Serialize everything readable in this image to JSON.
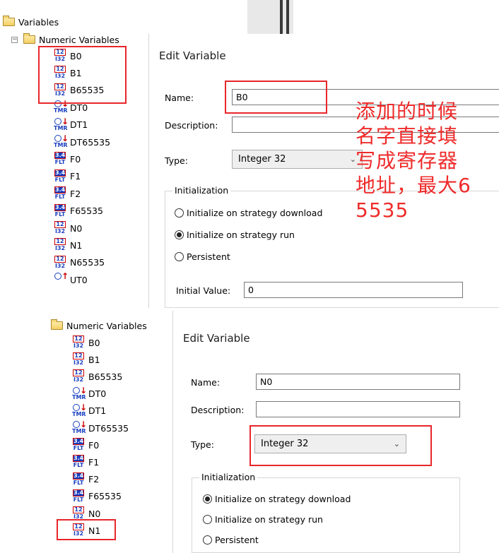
{
  "tree_top": {
    "root_label": "Variables",
    "folder_label": "Numeric Variables",
    "items": [
      {
        "label": "B0",
        "icon": "integer-32-icon",
        "badge_top": "12",
        "badge_bottom": "I32"
      },
      {
        "label": "B1",
        "icon": "integer-32-icon",
        "badge_top": "12",
        "badge_bottom": "I32"
      },
      {
        "label": "B65535",
        "icon": "integer-32-icon",
        "badge_top": "12",
        "badge_bottom": "I32"
      },
      {
        "label": "DT0",
        "icon": "timer-icon",
        "badge_top": "",
        "badge_bottom": "TMR"
      },
      {
        "label": "DT1",
        "icon": "timer-icon",
        "badge_top": "",
        "badge_bottom": "TMR"
      },
      {
        "label": "DT65535",
        "icon": "timer-icon",
        "badge_top": "",
        "badge_bottom": "TMR"
      },
      {
        "label": "F0",
        "icon": "float-icon",
        "badge_top": "3.4",
        "badge_bottom": "FLT"
      },
      {
        "label": "F1",
        "icon": "float-icon",
        "badge_top": "3.4",
        "badge_bottom": "FLT"
      },
      {
        "label": "F2",
        "icon": "float-icon",
        "badge_top": "3.4",
        "badge_bottom": "FLT"
      },
      {
        "label": "F65535",
        "icon": "float-icon",
        "badge_top": "3.4",
        "badge_bottom": "FLT"
      },
      {
        "label": "N0",
        "icon": "integer-32-icon",
        "badge_top": "12",
        "badge_bottom": "I32"
      },
      {
        "label": "N1",
        "icon": "integer-32-icon",
        "badge_top": "12",
        "badge_bottom": "I32"
      },
      {
        "label": "N65535",
        "icon": "integer-32-icon",
        "badge_top": "12",
        "badge_bottom": "I32"
      },
      {
        "label": "UT0",
        "icon": "up-timer-icon",
        "badge_top": "",
        "badge_bottom": ""
      }
    ]
  },
  "dialog_top": {
    "title": "Edit Variable",
    "name_label": "Name:",
    "name_value": "B0",
    "description_label": "Description:",
    "description_value": "",
    "type_label": "Type:",
    "type_value": "Integer 32",
    "init_group_title": "Initialization",
    "radio_download": "Initialize on strategy download",
    "radio_run": "Initialize on strategy run",
    "radio_persistent": "Persistent",
    "selected_radio": "run",
    "initial_value_label": "Initial Value:",
    "initial_value": "0"
  },
  "annotation": {
    "lines": [
      "添加的时候",
      "名字直接填",
      "写成寄存器",
      "地址，最大6",
      "5535"
    ],
    "color": "#ee2b2b"
  },
  "tree_bottom": {
    "folder_label": "Numeric Variables",
    "items": [
      {
        "label": "B0",
        "icon": "integer-32-icon",
        "badge_top": "12",
        "badge_bottom": "I32"
      },
      {
        "label": "B1",
        "icon": "integer-32-icon",
        "badge_top": "12",
        "badge_bottom": "I32"
      },
      {
        "label": "B65535",
        "icon": "integer-32-icon",
        "badge_top": "12",
        "badge_bottom": "I32"
      },
      {
        "label": "DT0",
        "icon": "timer-icon",
        "badge_top": "",
        "badge_bottom": "TMR"
      },
      {
        "label": "DT1",
        "icon": "timer-icon",
        "badge_top": "",
        "badge_bottom": "TMR"
      },
      {
        "label": "DT65535",
        "icon": "timer-icon",
        "badge_top": "",
        "badge_bottom": "TMR"
      },
      {
        "label": "F0",
        "icon": "float-icon",
        "badge_top": "3.4",
        "badge_bottom": "FLT"
      },
      {
        "label": "F1",
        "icon": "float-icon",
        "badge_top": "3.4",
        "badge_bottom": "FLT"
      },
      {
        "label": "F2",
        "icon": "float-icon",
        "badge_top": "3.4",
        "badge_bottom": "FLT"
      },
      {
        "label": "F65535",
        "icon": "float-icon",
        "badge_top": "3.4",
        "badge_bottom": "FLT"
      },
      {
        "label": "N0",
        "icon": "integer-32-icon",
        "badge_top": "12",
        "badge_bottom": "I32"
      },
      {
        "label": "N1",
        "icon": "integer-32-icon",
        "badge_top": "12",
        "badge_bottom": "I32"
      }
    ]
  },
  "dialog_bottom": {
    "title": "Edit Variable",
    "name_label": "Name:",
    "name_value": "N0",
    "description_label": "Description:",
    "description_value": "",
    "type_label": "Type:",
    "type_value": "Integer 32",
    "init_group_title": "Initialization",
    "radio_download": "Initialize on strategy download",
    "radio_run": "Initialize on strategy run",
    "radio_persistent": "Persistent",
    "selected_radio": "download"
  },
  "colors": {
    "highlight": "#e8262b",
    "icon_blue": "#1a3fbf"
  }
}
